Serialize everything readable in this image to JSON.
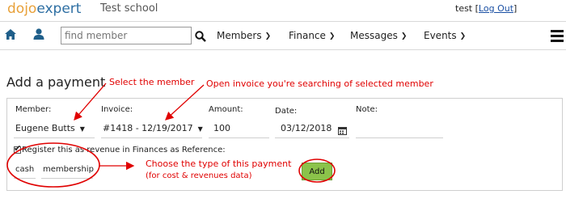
{
  "header": {
    "logo_part1": "dojo",
    "logo_part2": "expert",
    "school_name": "Test school",
    "username": "test",
    "logout_label": "Log Out"
  },
  "nav": {
    "search_placeholder": "find member",
    "menus": [
      {
        "label": "Members"
      },
      {
        "label": "Finance"
      },
      {
        "label": "Messages"
      },
      {
        "label": "Events"
      }
    ]
  },
  "page": {
    "title": "Add a payment"
  },
  "form": {
    "member_label": "Member:",
    "member_value": "Eugene Butts",
    "invoice_label": "Invoice:",
    "invoice_value": "#1418 - 12/19/2017",
    "amount_label": "Amount:",
    "amount_value": "100",
    "date_label": "Date:",
    "date_value": "03/12/2018",
    "note_label": "Note:",
    "note_value": "",
    "register_label": "Register this as revenue in Finances as Reference:",
    "register_checked": true,
    "ref_type_value": "cash",
    "ref_category_value": "membership",
    "add_label": "Add"
  },
  "annotations": {
    "select_member": "Select the member",
    "open_invoice": "Open invoice you're searching of selected member",
    "choose_type_line1": "Choose the type of this payment",
    "choose_type_line2": "(for cost & revenues data)",
    "color": "#e00000"
  },
  "colors": {
    "logo_orange": "#e8a13a",
    "logo_blue": "#2e6fa3",
    "add_button": "#8bc34a",
    "annotation_red": "#e00000"
  }
}
